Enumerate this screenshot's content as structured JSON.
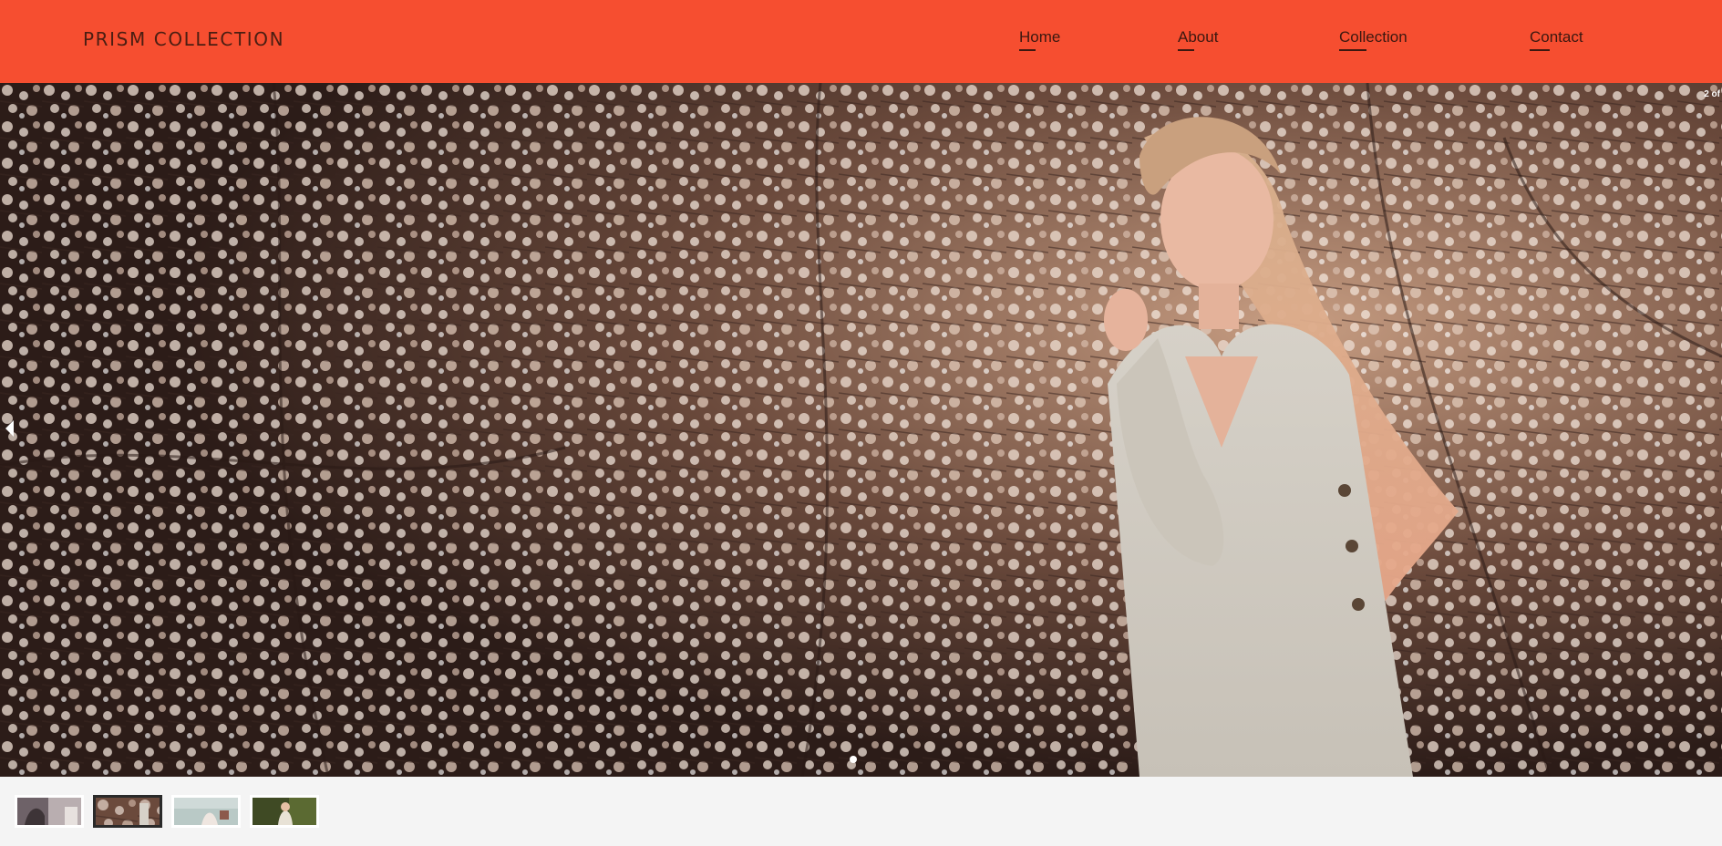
{
  "header": {
    "brand": "PRISM COLLECTION",
    "nav": [
      {
        "label": "Home"
      },
      {
        "label": "About"
      },
      {
        "label": "Collection"
      },
      {
        "label": "Contact"
      }
    ]
  },
  "slideshow": {
    "counter": "2 of",
    "current_slide": 2,
    "image_alt": "Woman in a linen dress among white blossoming branches",
    "thumbnails": [
      {
        "name": "slide-1",
        "active": false
      },
      {
        "name": "slide-2",
        "active": true
      },
      {
        "name": "slide-3",
        "active": false
      },
      {
        "name": "slide-4",
        "active": false
      }
    ]
  },
  "colors": {
    "header_bg": "#f64e30",
    "nav_text": "#3b1810",
    "footer_bg": "#f4f4f4"
  }
}
